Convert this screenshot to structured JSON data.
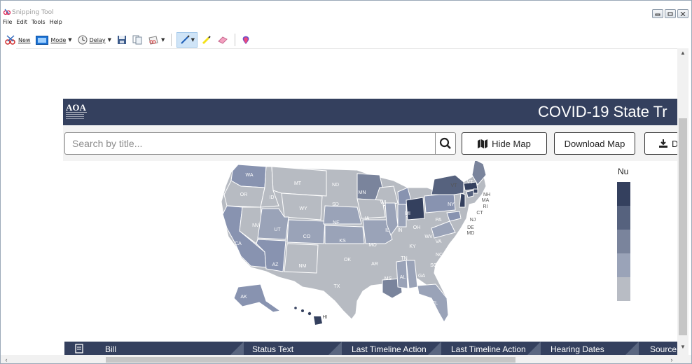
{
  "window": {
    "title": "Snipping Tool",
    "menu": [
      "File",
      "Edit",
      "Tools",
      "Help"
    ],
    "toolbar": {
      "new_label": "New",
      "mode_label": "Mode",
      "delay_label": "Delay"
    }
  },
  "site": {
    "logo_text": "AOA",
    "logo_subtext": "AMERICAN OSTEOPATHIC ASSOCIATION",
    "title": "COVID-19 State Tr",
    "search_placeholder": "Search by title...",
    "hide_map_label": "Hide Map",
    "download_map_label": "Download Map",
    "download_cut_label": "D",
    "legend_label": "Nu",
    "legend_colors": [
      "#34405e",
      "#56627e",
      "#7a849c",
      "#9aa3b8",
      "#b8bcc4"
    ],
    "map_state_labels": [
      "WA",
      "OR",
      "CA",
      "NV",
      "ID",
      "MT",
      "WY",
      "UT",
      "AZ",
      "CO",
      "NM",
      "ND",
      "SD",
      "NE",
      "KS",
      "OK",
      "TX",
      "MN",
      "IA",
      "MO",
      "AR",
      "LA",
      "WI",
      "IL",
      "MI",
      "IN",
      "OH",
      "KY",
      "TN",
      "MS",
      "AL",
      "GA",
      "FL",
      "SC",
      "NC",
      "VA",
      "WV",
      "PA",
      "NY",
      "VT",
      "ME",
      "NH",
      "MA",
      "RI",
      "CT",
      "NJ",
      "DE",
      "MD",
      "AK",
      "HI"
    ],
    "table_columns": [
      "Bill",
      "Status Text",
      "Last Timeline Action",
      "Last Timeline Action",
      "Hearing Dates",
      "Source"
    ]
  }
}
